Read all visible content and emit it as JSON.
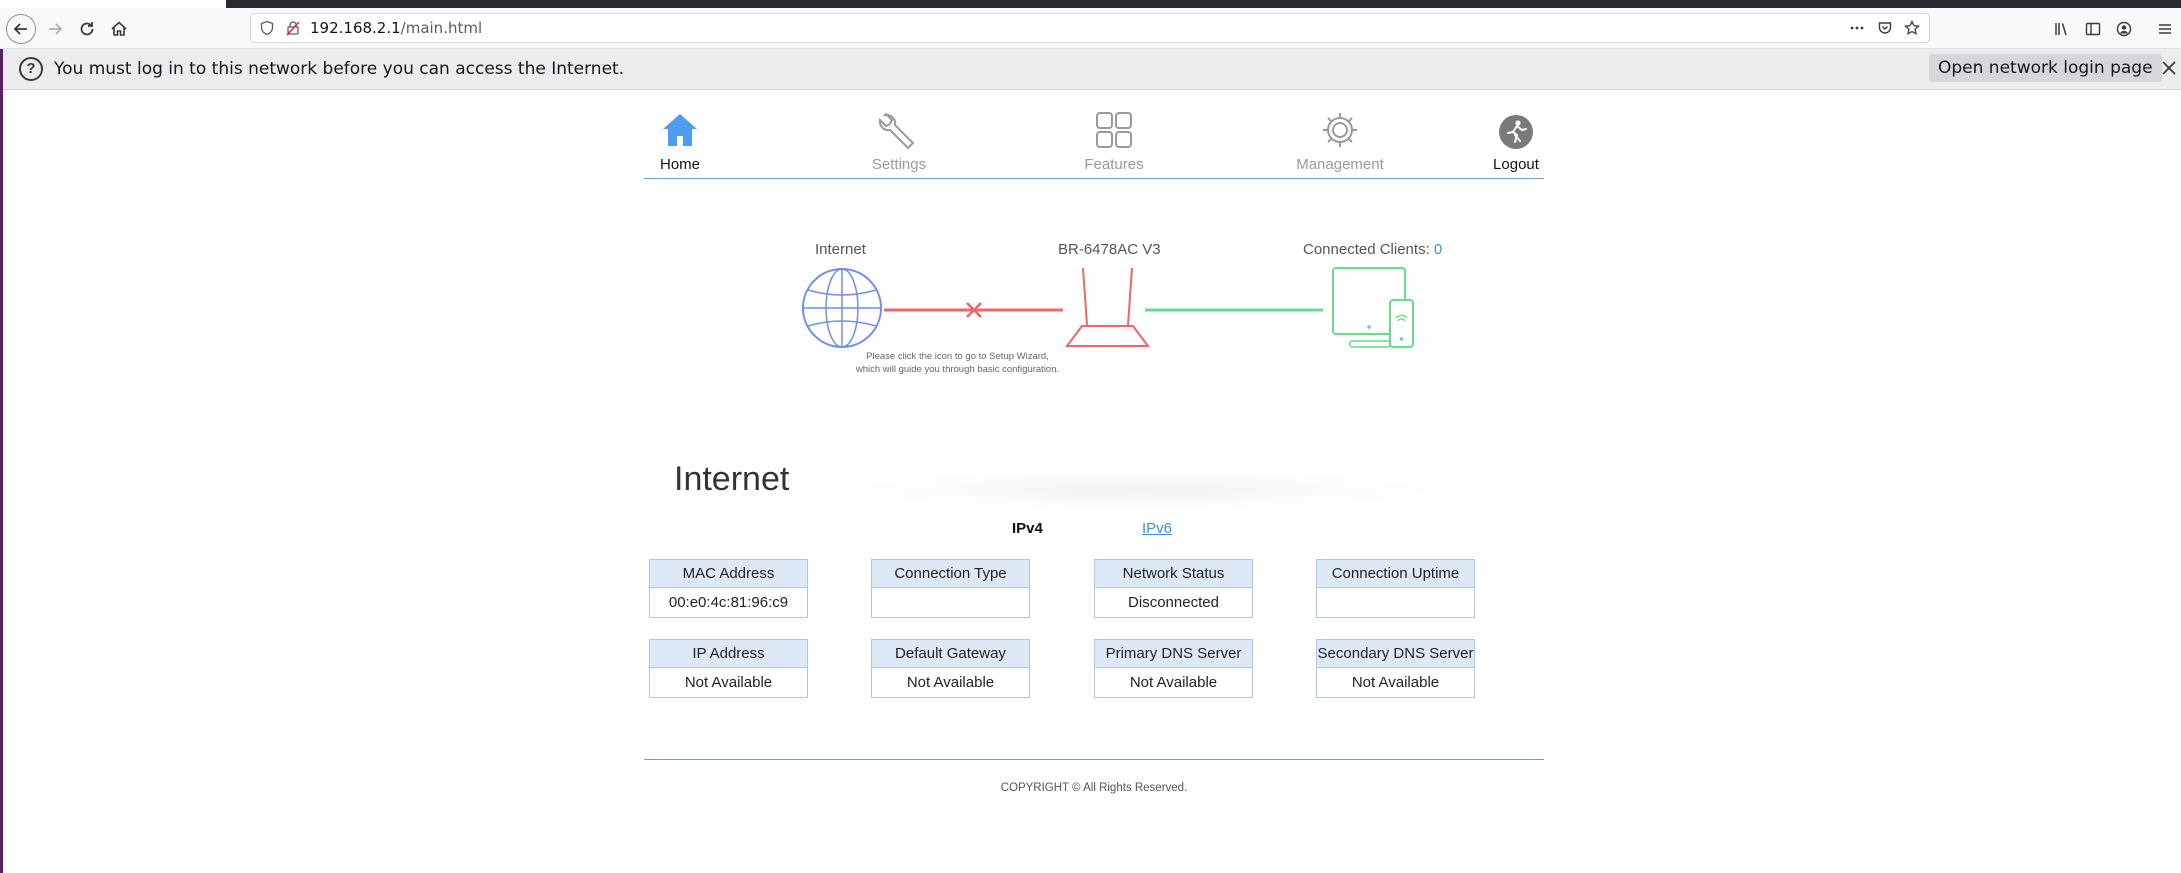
{
  "browser": {
    "url_host": "192.168.2.1",
    "url_path": "/main.html"
  },
  "notification": {
    "message": "You must log in to this network before you can access the Internet.",
    "button": "Open network login page"
  },
  "nav": {
    "items": [
      {
        "label": "Home",
        "icon": "home-icon"
      },
      {
        "label": "Settings",
        "icon": "wrench-icon"
      },
      {
        "label": "Features",
        "icon": "grid-icon"
      },
      {
        "label": "Management",
        "icon": "gear-icon"
      },
      {
        "label": "Logout",
        "icon": "logout-icon"
      }
    ]
  },
  "diagram": {
    "internet_label": "Internet",
    "router_label": "BR-6478AC V3",
    "clients_label": "Connected Clients:",
    "clients_count": "0",
    "hint_line1": "Please click the icon to go to Setup Wizard,",
    "hint_line2": "which will guide you through basic configuration.",
    "colors": {
      "disconnected": "#ee6666",
      "connected": "#66dd88",
      "globe": "#6f8fe8"
    }
  },
  "internet": {
    "title": "Internet",
    "tab_ipv4": "IPv4",
    "tab_ipv6": "IPv6",
    "fields": [
      {
        "label": "MAC Address",
        "value": "00:e0:4c:81:96:c9"
      },
      {
        "label": "Connection Type",
        "value": ""
      },
      {
        "label": "Network Status",
        "value": "Disconnected"
      },
      {
        "label": "Connection Uptime",
        "value": ""
      },
      {
        "label": "IP Address",
        "value": "Not Available"
      },
      {
        "label": "Default Gateway",
        "value": "Not Available"
      },
      {
        "label": "Primary DNS Server",
        "value": "Not Available"
      },
      {
        "label": "Secondary DNS Server",
        "value": "Not Available"
      }
    ]
  },
  "footer": {
    "copyright": "COPYRIGHT © All Rights Reserved."
  }
}
